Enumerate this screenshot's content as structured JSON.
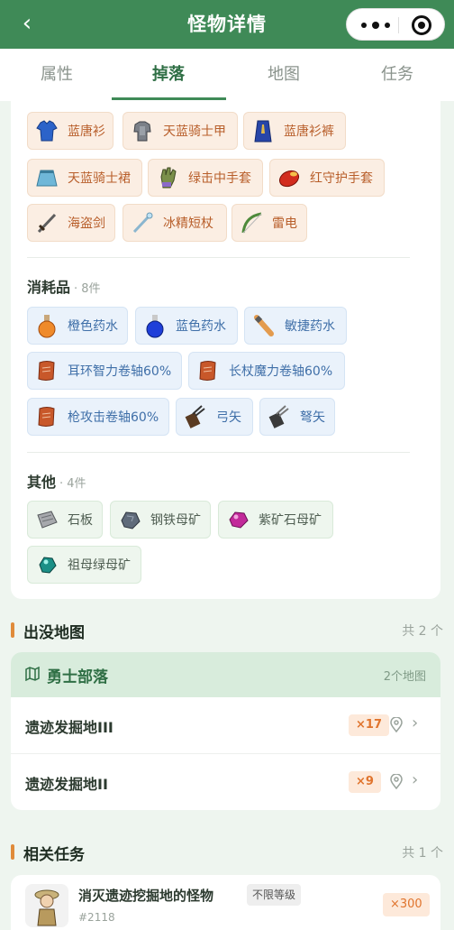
{
  "header": {
    "back_icon": "chevron-left-icon",
    "title": "怪物详情"
  },
  "tabs": [
    {
      "label": "属性",
      "active": false
    },
    {
      "label": "掉落",
      "active": true
    },
    {
      "label": "地图",
      "active": false
    },
    {
      "label": "任务",
      "active": false
    }
  ],
  "drops": {
    "equipment": [
      {
        "name": "蓝唐衫",
        "icon": "blue-shirt-icon"
      },
      {
        "name": "天蓝骑士甲",
        "icon": "armor-icon"
      },
      {
        "name": "蓝唐衫裤",
        "icon": "blue-robe-icon"
      },
      {
        "name": "天蓝骑士裙",
        "icon": "skirt-icon"
      },
      {
        "name": "绿击中手套",
        "icon": "green-glove-icon"
      },
      {
        "name": "红守护手套",
        "icon": "red-glove-icon"
      },
      {
        "name": "海盗剑",
        "icon": "sword-icon"
      },
      {
        "name": "冰精短杖",
        "icon": "wand-icon"
      },
      {
        "name": "雷电",
        "icon": "bow-icon"
      }
    ],
    "consumables": {
      "title": "消耗品",
      "count": "· 8件",
      "items": [
        {
          "name": "橙色药水",
          "icon": "orange-potion-icon"
        },
        {
          "name": "蓝色药水",
          "icon": "blue-potion-icon"
        },
        {
          "name": "敏捷药水",
          "icon": "agility-potion-icon"
        },
        {
          "name": "耳环智力卷轴60%",
          "icon": "scroll-icon"
        },
        {
          "name": "长杖魔力卷轴60%",
          "icon": "scroll-icon"
        },
        {
          "name": "枪攻击卷轴60%",
          "icon": "scroll-icon"
        },
        {
          "name": "弓矢",
          "icon": "arrows-icon"
        },
        {
          "name": "弩矢",
          "icon": "bolts-icon"
        }
      ]
    },
    "others": {
      "title": "其他",
      "count": "· 4件",
      "items": [
        {
          "name": "石板",
          "icon": "stone-tablet-icon"
        },
        {
          "name": "钢铁母矿",
          "icon": "steel-ore-icon"
        },
        {
          "name": "紫矿石母矿",
          "icon": "purple-ore-icon"
        },
        {
          "name": "祖母绿母矿",
          "icon": "emerald-ore-icon"
        }
      ]
    }
  },
  "maps_section": {
    "title": "出没地图",
    "total": "共 2 个",
    "group": {
      "icon": "map-icon",
      "name": "勇士部落",
      "count": "2个地图"
    },
    "rows": [
      {
        "name": "遗迹发掘地III",
        "badge": "×17"
      },
      {
        "name": "遗迹发掘地II",
        "badge": "×9"
      }
    ]
  },
  "tasks_section": {
    "title": "相关任务",
    "total": "共 1 个",
    "task": {
      "name": "消灭遗迹挖掘地的怪物",
      "tag": "不限等级",
      "id": "#2118",
      "reward": "×300"
    }
  },
  "colors": {
    "header_bg": "#3f8a57",
    "accent_orange": "#e08b3a",
    "equip_chip": "#fbeee3",
    "consumable_chip": "#eaf2fb",
    "other_chip": "#eef6ee"
  }
}
